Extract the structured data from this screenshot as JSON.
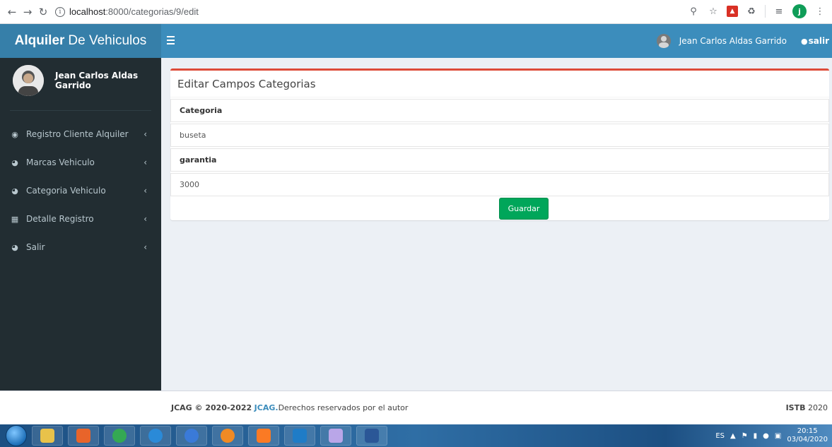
{
  "browser": {
    "url_host": "localhost",
    "url_path": ":8000/categorias/9/edit",
    "info_glyph": "i",
    "profile_initial": "j"
  },
  "header": {
    "brand_bold": "Alquiler",
    "brand_rest": "De Vehiculos",
    "user_name": "Jean Carlos Aldas Garrido",
    "salir_label": "salir"
  },
  "sidebar": {
    "user_name": "Jean Carlos Aldas Garrido",
    "items": [
      {
        "label": "Registro Cliente Alquiler",
        "icon": "users-icon"
      },
      {
        "label": "Marcas Vehiculo",
        "icon": "pie-icon"
      },
      {
        "label": "Categoria Vehiculo",
        "icon": "pie-icon"
      },
      {
        "label": "Detalle Registro",
        "icon": "table-icon"
      },
      {
        "label": "Salir",
        "icon": "pie-icon"
      }
    ]
  },
  "form": {
    "title": "Editar Campos Categorias",
    "field1_label": "Categoria",
    "field1_value": "buseta",
    "field2_label": "garantia",
    "field2_value": "3000",
    "submit_label": "Guardar"
  },
  "footer": {
    "left_bold": "JCAG © 2020-2022",
    "left_link": "JCAG.",
    "left_text": "Derechos reservados por el autor",
    "right_bold": "ISTB",
    "right_text": "2020"
  },
  "taskbar": {
    "lang": "ES",
    "time": "20:15",
    "date": "03/04/2020"
  },
  "colors": {
    "header": "#3c8dbc",
    "logo_bg": "#367fa9",
    "sidebar": "#222d32",
    "box_top_border": "#dd4b39",
    "button": "#00a65a"
  }
}
